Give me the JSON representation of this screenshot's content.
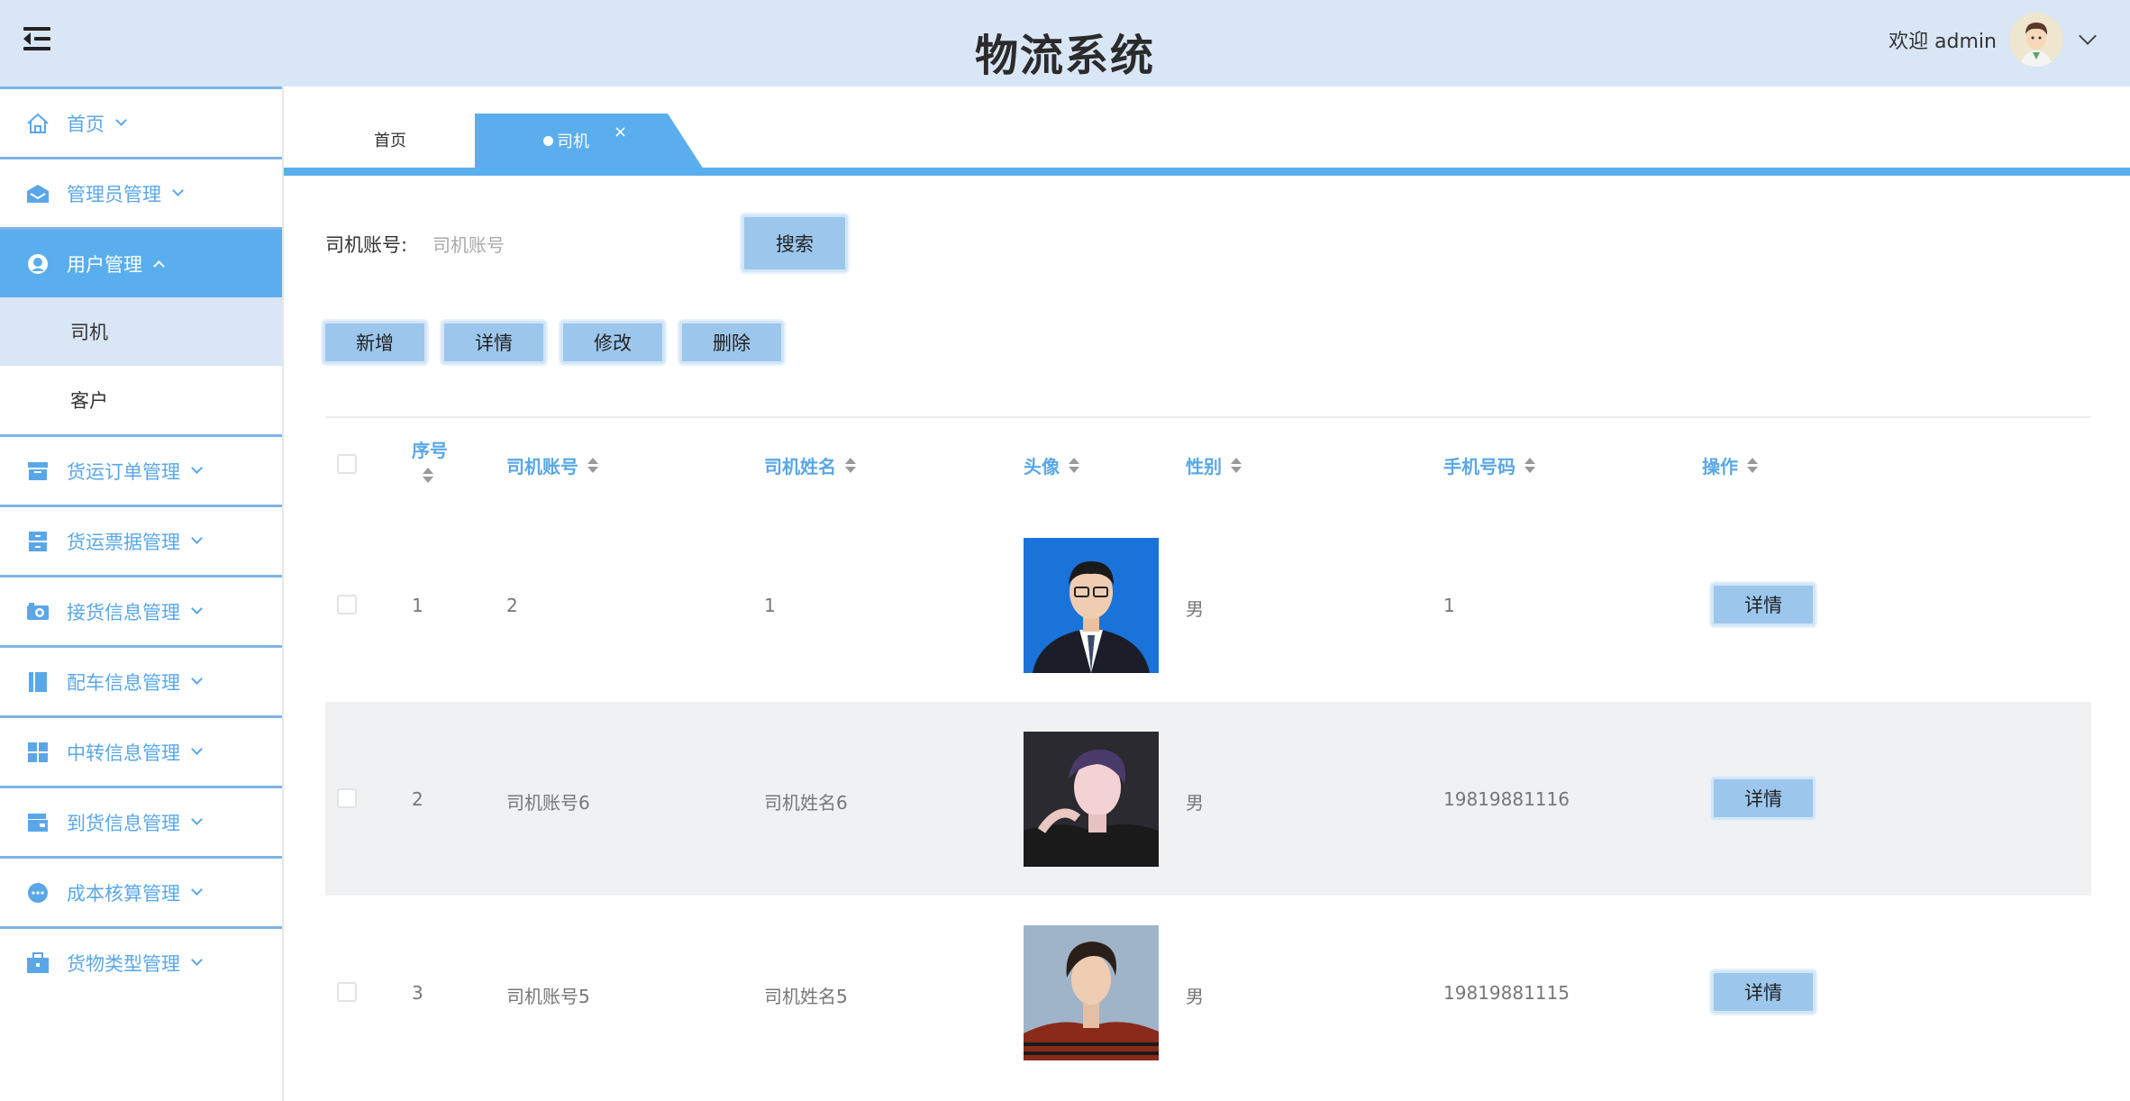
{
  "header": {
    "title": "物流系统",
    "welcome": "欢迎 admin"
  },
  "sidebar": {
    "items": [
      {
        "label": "首页",
        "icon": "home-icon"
      },
      {
        "label": "管理员管理",
        "icon": "mail-icon"
      },
      {
        "label": "用户管理",
        "icon": "user-icon",
        "expanded": true,
        "children": [
          {
            "label": "司机",
            "active": true
          },
          {
            "label": "客户"
          }
        ]
      },
      {
        "label": "货运订单管理",
        "icon": "box-icon"
      },
      {
        "label": "货运票据管理",
        "icon": "cabinet-icon"
      },
      {
        "label": "接货信息管理",
        "icon": "camera-icon"
      },
      {
        "label": "配车信息管理",
        "icon": "book-icon"
      },
      {
        "label": "中转信息管理",
        "icon": "grid-icon"
      },
      {
        "label": "到货信息管理",
        "icon": "wallet-icon"
      },
      {
        "label": "成本核算管理",
        "icon": "more-icon"
      },
      {
        "label": "货物类型管理",
        "icon": "briefcase-icon"
      }
    ]
  },
  "tabs": {
    "home": "首页",
    "active": "司机",
    "close": "×"
  },
  "search": {
    "label": "司机账号:",
    "placeholder": "司机账号",
    "value": "",
    "button": "搜索"
  },
  "toolbar": {
    "add": "新增",
    "detail": "详情",
    "edit": "修改",
    "delete": "删除"
  },
  "table": {
    "headers": {
      "index": "序号",
      "account": "司机账号",
      "name": "司机姓名",
      "avatar": "头像",
      "gender": "性别",
      "phone": "手机号码",
      "action": "操作"
    },
    "rows": [
      {
        "index": "1",
        "account": "2",
        "name": "1",
        "gender": "男",
        "phone": "1",
        "action": "详情"
      },
      {
        "index": "2",
        "account": "司机账号6",
        "name": "司机姓名6",
        "gender": "男",
        "phone": "19819881116",
        "action": "详情"
      },
      {
        "index": "3",
        "account": "司机账号5",
        "name": "司机姓名5",
        "gender": "男",
        "phone": "19819881115",
        "action": "详情"
      }
    ]
  },
  "colors": {
    "accent": "#5aaeed",
    "header_bg": "#d9e6f6",
    "button_bg": "#9cc6ec",
    "menu_text": "#5aa7e8"
  }
}
